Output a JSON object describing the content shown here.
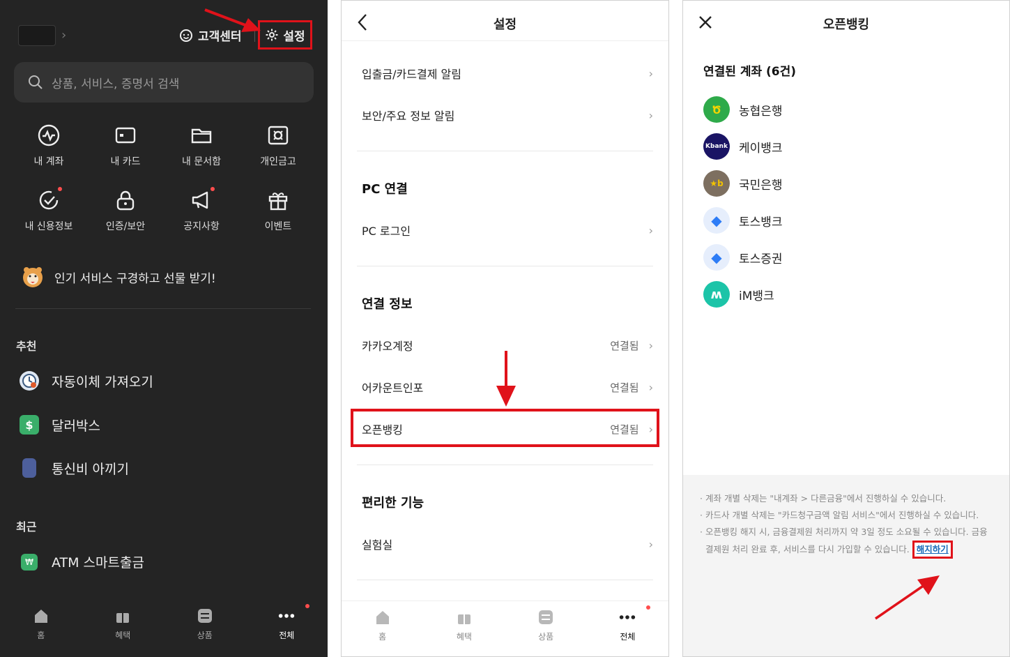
{
  "panel1": {
    "customer_center": "고객센터",
    "settings": "설정",
    "search_placeholder": "상품, 서비스, 증명서 검색",
    "grid": [
      {
        "label": "내 계좌",
        "icon": "wave-circle-icon"
      },
      {
        "label": "내 카드",
        "icon": "card-icon"
      },
      {
        "label": "내 문서함",
        "icon": "folder-icon"
      },
      {
        "label": "개인금고",
        "icon": "safe-icon"
      },
      {
        "label": "내 신용정보",
        "icon": "check-circle-icon"
      },
      {
        "label": "인증/보안",
        "icon": "lock-icon"
      },
      {
        "label": "공지사항",
        "icon": "megaphone-icon"
      },
      {
        "label": "이벤트",
        "icon": "gift-icon"
      }
    ],
    "promo": "인기 서비스 구경하고 선물 받기!",
    "recommend_title": "추천",
    "recommend": [
      "자동이체 가져오기",
      "달러박스",
      "통신비 아끼기"
    ],
    "recent_title": "최근",
    "recent": [
      "ATM 스마트출금"
    ],
    "nav": [
      "홈",
      "혜택",
      "상품",
      "전체"
    ]
  },
  "panel2": {
    "title": "설정",
    "rows_top": [
      "입출금/카드결제 알림",
      "보안/주요 정보 알림"
    ],
    "sec_pc": "PC 연결",
    "pc_login": "PC 로그인",
    "sec_conn": "연결 정보",
    "conn_rows": [
      {
        "label": "카카오계정",
        "status": "연결됨"
      },
      {
        "label": "어카운트인포",
        "status": "연결됨"
      },
      {
        "label": "오픈뱅킹",
        "status": "연결됨"
      }
    ],
    "sec_feature": "편리한 기능",
    "lab": "실험실",
    "nav": [
      "홈",
      "혜택",
      "상품",
      "전체"
    ]
  },
  "panel3": {
    "title": "오픈뱅킹",
    "subtitle": "연결된 계좌 (6건)",
    "banks": [
      {
        "name": "농협은행",
        "color": "#2eaa4a",
        "mark": "Ծ"
      },
      {
        "name": "케이뱅크",
        "color": "#1a1464",
        "mark": "Kbank"
      },
      {
        "name": "국민은행",
        "color": "#7d6f60",
        "mark": "★b"
      },
      {
        "name": "토스뱅크",
        "color": "#e6eefc",
        "mark": "◆"
      },
      {
        "name": "토스증권",
        "color": "#e6eefc",
        "mark": "◆"
      },
      {
        "name": "iM뱅크",
        "color": "#1cc4a8",
        "mark": "ʍ"
      }
    ],
    "notes": [
      "계좌 개별 삭제는 \"내계좌 > 다른금융\"에서 진행하실 수 있습니다.",
      "카드사 개별 삭제는 \"카드청구금액 알림 서비스\"에서 진행하실 수 있습니다.",
      "오픈뱅킹 해지 시, 금융결제원 처리까지 약 3일 정도 소요될 수 있습니다. 금융결제원 처리 완료 후, 서비스를 다시 가입할 수 있습니다."
    ],
    "cancel": "해지하기"
  },
  "colors": {
    "highlight": "#e0121a",
    "dark_bg": "#242424",
    "link": "#1668b8"
  }
}
